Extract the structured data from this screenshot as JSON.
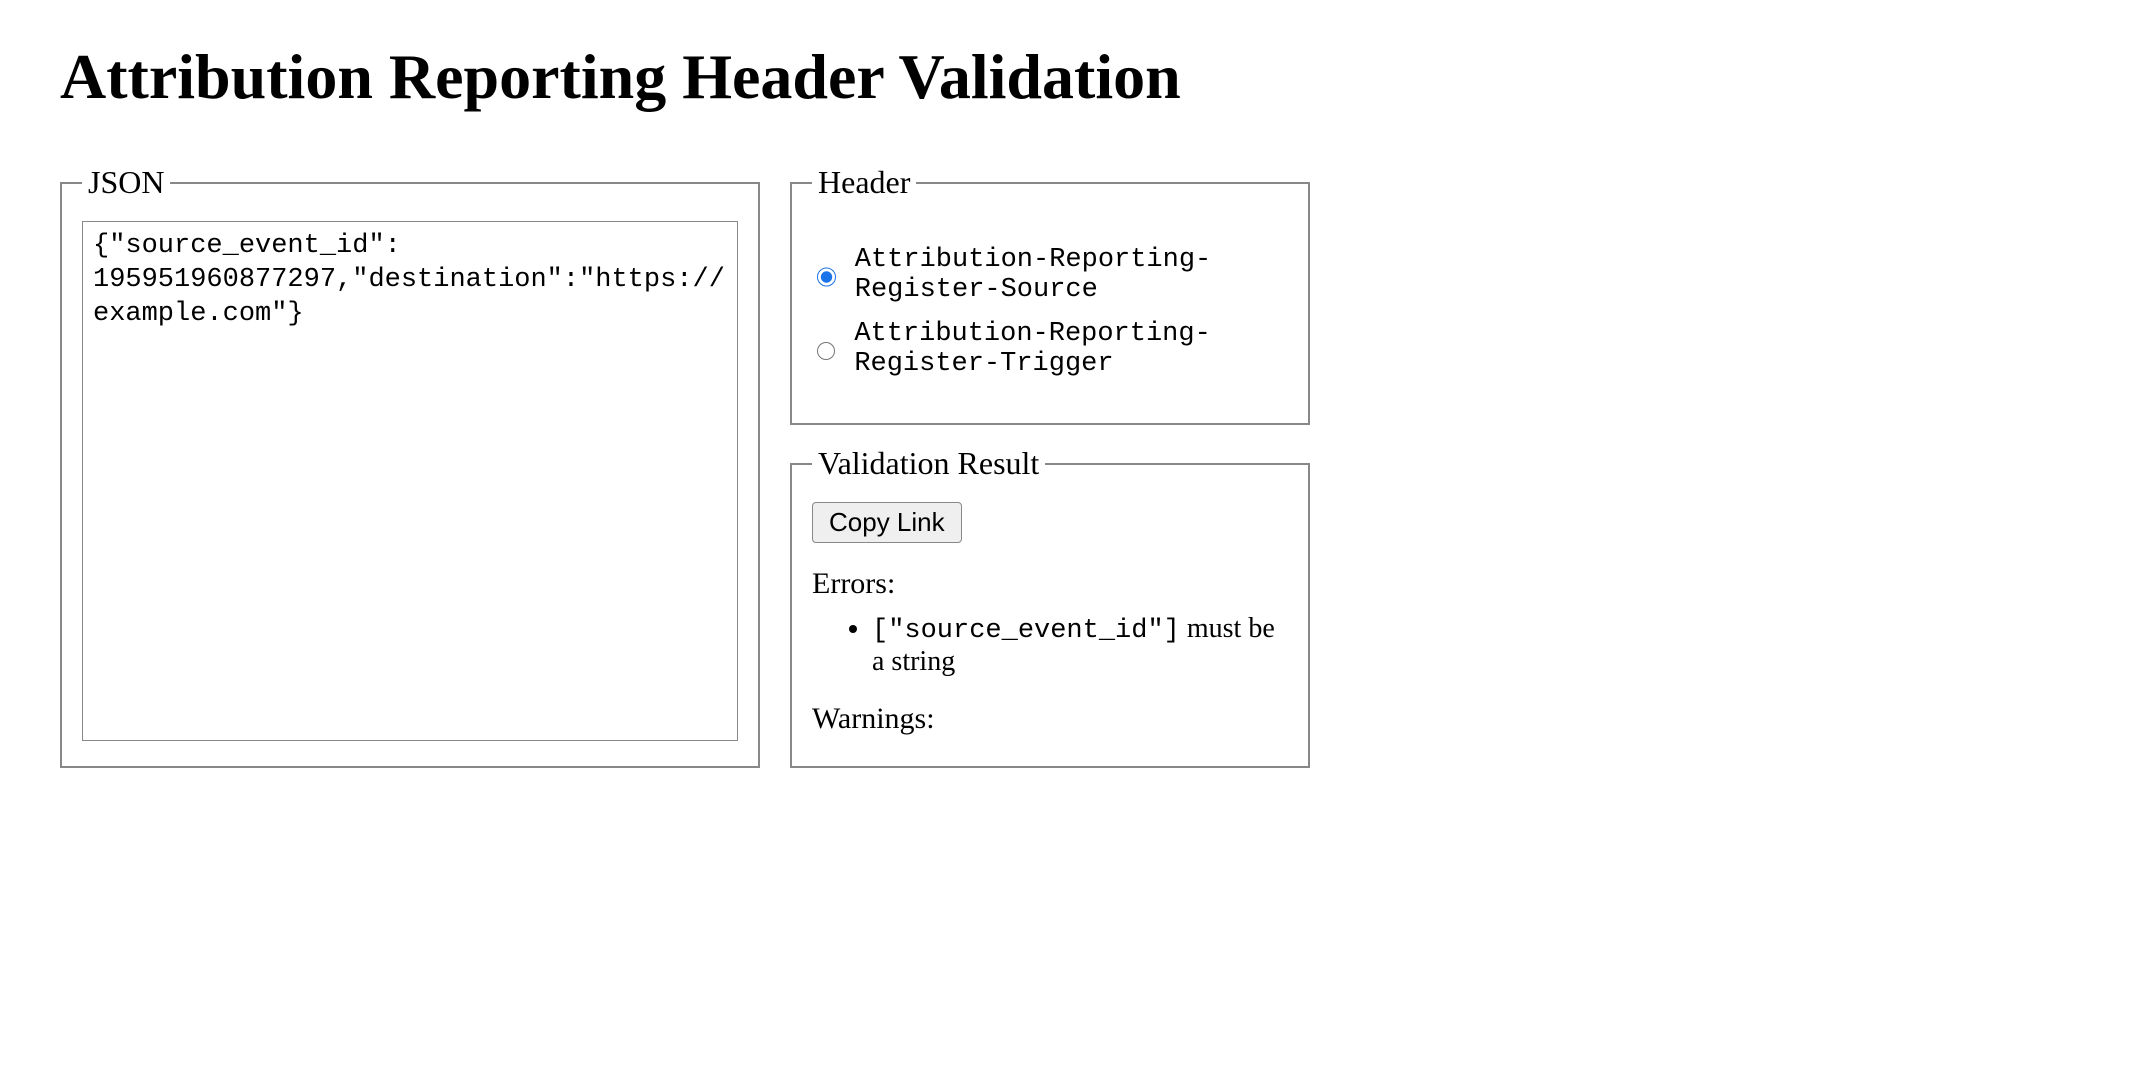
{
  "title": "Attribution Reporting Header Validation",
  "json_panel": {
    "legend": "JSON",
    "textarea_value": "{\"source_event_id\": 195951960877297,\"destination\":\"https://example.com\"}"
  },
  "header_panel": {
    "legend": "Header",
    "options": [
      {
        "label": "Attribution-Reporting-Register-Source",
        "checked": true
      },
      {
        "label": "Attribution-Reporting-Register-Trigger",
        "checked": false
      }
    ]
  },
  "result_panel": {
    "legend": "Validation Result",
    "copy_button": "Copy Link",
    "errors_label": "Errors:",
    "warnings_label": "Warnings:",
    "errors": [
      {
        "path": "[\"source_event_id\"]",
        "message": "must be a string"
      }
    ],
    "warnings": []
  }
}
